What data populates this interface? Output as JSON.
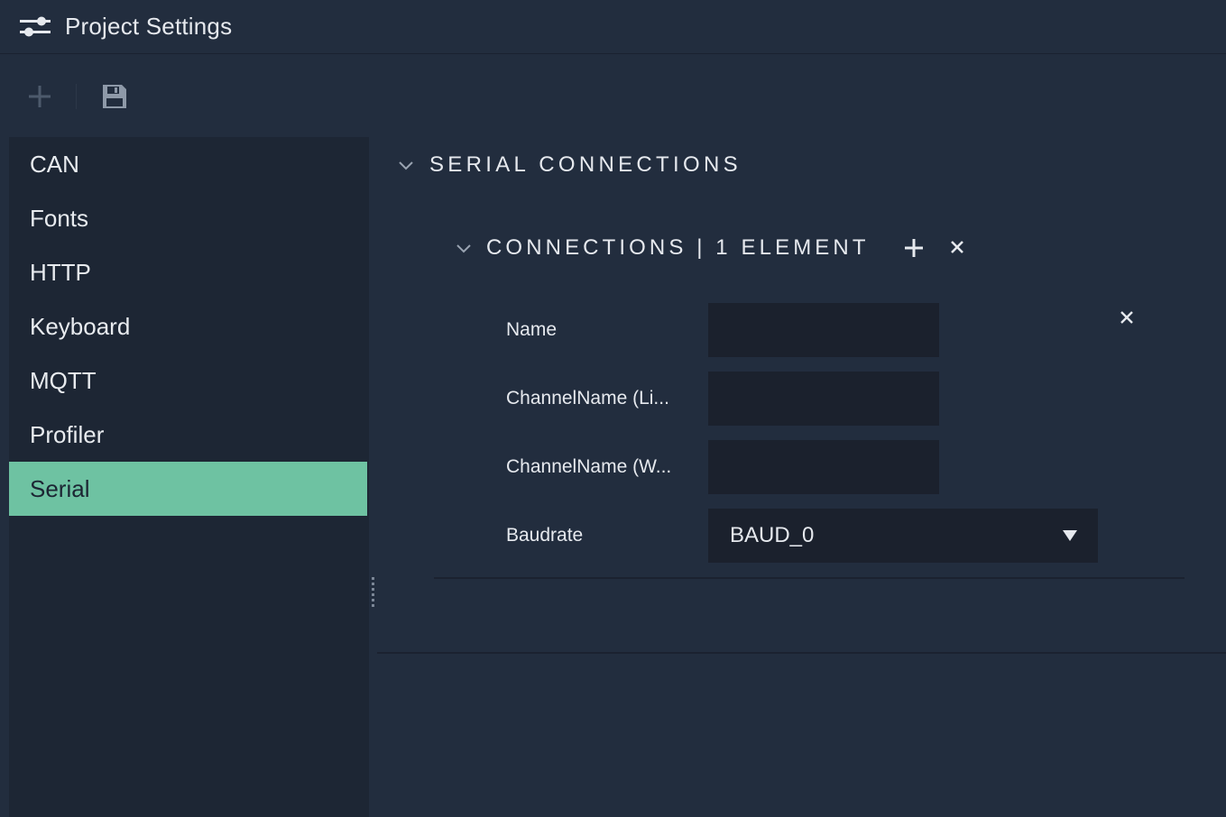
{
  "window": {
    "title": "Project Settings",
    "icon": "settings-sliders-icon"
  },
  "toolbar": {
    "add_icon": "plus-icon",
    "save_icon": "floppy-disk-icon"
  },
  "sidebar": {
    "items": [
      {
        "label": "CAN",
        "active": false
      },
      {
        "label": "Fonts",
        "active": false
      },
      {
        "label": "HTTP",
        "active": false
      },
      {
        "label": "Keyboard",
        "active": false
      },
      {
        "label": "MQTT",
        "active": false
      },
      {
        "label": "Profiler",
        "active": false
      },
      {
        "label": "Serial",
        "active": true
      }
    ]
  },
  "main": {
    "section_title": "SERIAL CONNECTIONS",
    "connections": {
      "title": "CONNECTIONS | 1 ELEMENT",
      "fields": [
        {
          "label": "Name",
          "value": ""
        },
        {
          "label": "ChannelName (Li...",
          "value": ""
        },
        {
          "label": "ChannelName (W...",
          "value": ""
        }
      ],
      "baudrate": {
        "label": "Baudrate",
        "value": "BAUD_0"
      }
    }
  },
  "colors": {
    "background": "#222d3e",
    "sidebar": "#1d2634",
    "active_item": "#6ec2a2",
    "input_bg": "#1b212d"
  }
}
